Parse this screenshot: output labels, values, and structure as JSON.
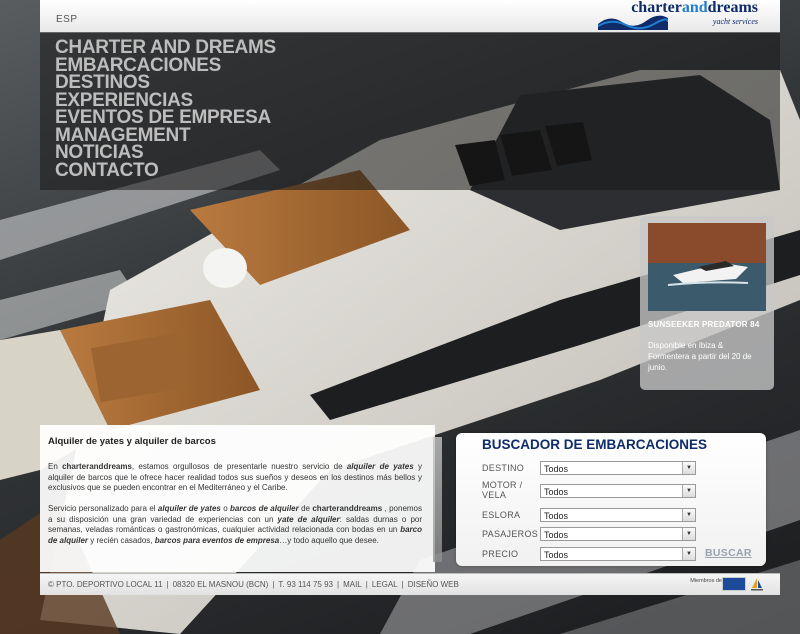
{
  "header": {
    "language": "ESP",
    "logo": {
      "name_part1": "charter",
      "name_part2": "and",
      "name_part3": "dreams",
      "subtitle": "yacht services"
    }
  },
  "nav": {
    "items": [
      {
        "label": "CHARTER AND DREAMS"
      },
      {
        "label": "EMBARCACIONES"
      },
      {
        "label": "DESTINOS"
      },
      {
        "label": "EXPERIENCIAS"
      },
      {
        "label": "EVENTOS DE EMPRESA"
      },
      {
        "label": "MANAGEMENT"
      },
      {
        "label": "NOTICIAS"
      },
      {
        "label": "CONTACTO"
      }
    ]
  },
  "featured": {
    "title": "SUNSEEKER PREDATOR 84",
    "description": "Disponible en Ibiza & Formentera a partir del 20 de junio."
  },
  "info": {
    "heading": "Alquiler de yates y alquiler de barcos",
    "p1": {
      "t1": "En ",
      "b1": "charteranddreams",
      "t2": ", estamos orgullosos de presentarle nuestro servicio de ",
      "k1": "alquiler de yates",
      "t3": " y alquiler de barcos que le ofrece hacer realidad todos sus sueños y deseos en los destinos más bellos y exclusivos que se pueden encontrar en el Mediterráneo y el Caribe."
    },
    "p2": {
      "t1": "Servicio personalizado para el ",
      "k1": "alquiler de yates",
      "t2": " o ",
      "k2": "barcos de alquiler",
      "t3": " de ",
      "b1": "charteranddreams",
      "t4": " , ponemos a su disposición una gran variedad de experiencias con un ",
      "k3": "yate de alquiler",
      "t5": ": saldas durnas o por semanas, veladas románticas o gastronómicas, cualquier actividad relacionada con bodas en un ",
      "k4": "barco de alquiler",
      "t6": " y recién casados, ",
      "k5": "barcos para eventos de empresa",
      "t7": "…y todo aquello que desee."
    }
  },
  "search": {
    "title": "BUSCADOR DE EMBARCACIONES",
    "fields": [
      {
        "label": "DESTINO",
        "value": "Todos"
      },
      {
        "label": "MOTOR / VELA",
        "value": "Todos"
      },
      {
        "label": "ESLORA",
        "value": "Todos"
      },
      {
        "label": "PASAJEROS",
        "value": "Todos"
      },
      {
        "label": "PRECIO",
        "value": "Todos"
      }
    ],
    "button": "BUSCAR"
  },
  "footer": {
    "address": "© PTO. DEPORTIVO LOCAL 11",
    "city": "08320 EL MASNOU (BCN)",
    "phone": "T. 93 114 75 93",
    "links": [
      "MAIL",
      "LEGAL",
      "DISEÑO WEB"
    ],
    "members": "Miembros de"
  },
  "colors": {
    "brand_navy": "#0f2b69",
    "brand_blue": "#1f7ecf",
    "nav_text": "#bdbdbd"
  }
}
